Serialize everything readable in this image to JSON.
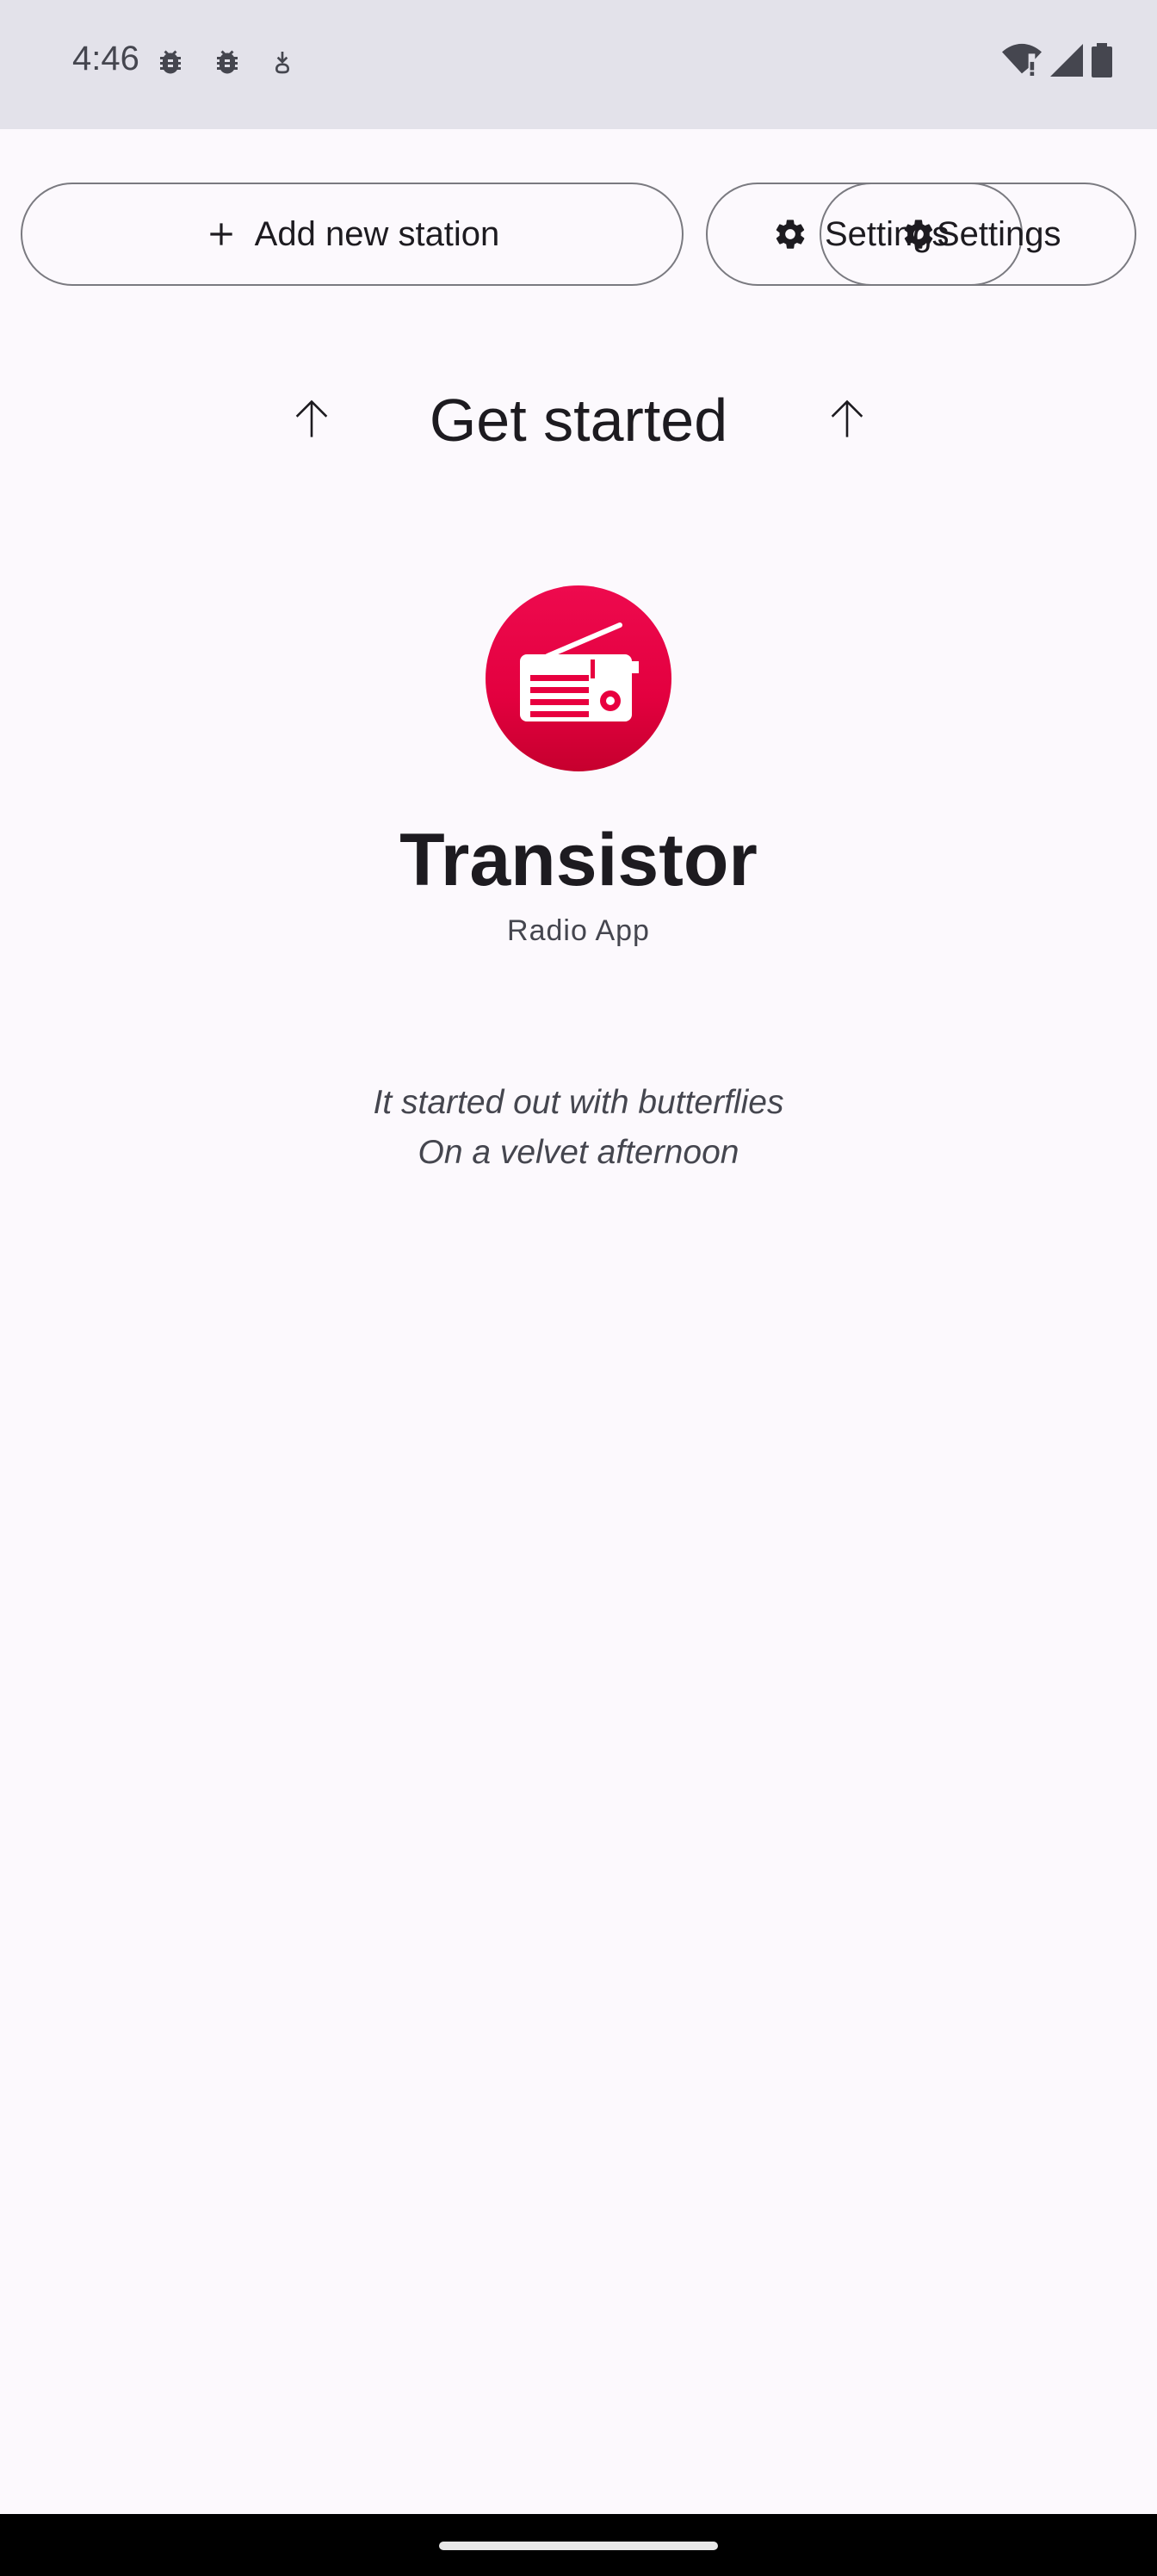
{
  "status_bar": {
    "time": "4:46",
    "left_icons": [
      "bug-icon",
      "bug-icon",
      "download-icon"
    ],
    "right_icons": [
      "wifi-alert-icon",
      "cell-signal-icon",
      "battery-icon"
    ]
  },
  "actions": {
    "add_station_label": "Add new station",
    "settings_label_1": "Settings",
    "settings_label_2": "Settings"
  },
  "hero": {
    "heading": "Get started",
    "app_name": "Transistor",
    "app_subtitle": "Radio App",
    "lyric_line_1": "It started out with butterflies",
    "lyric_line_2": "On a velvet afternoon"
  },
  "colors": {
    "logo_red": "#e8003f",
    "background": "#fcf9fd",
    "status_bar_bg": "#e3e2ea"
  }
}
